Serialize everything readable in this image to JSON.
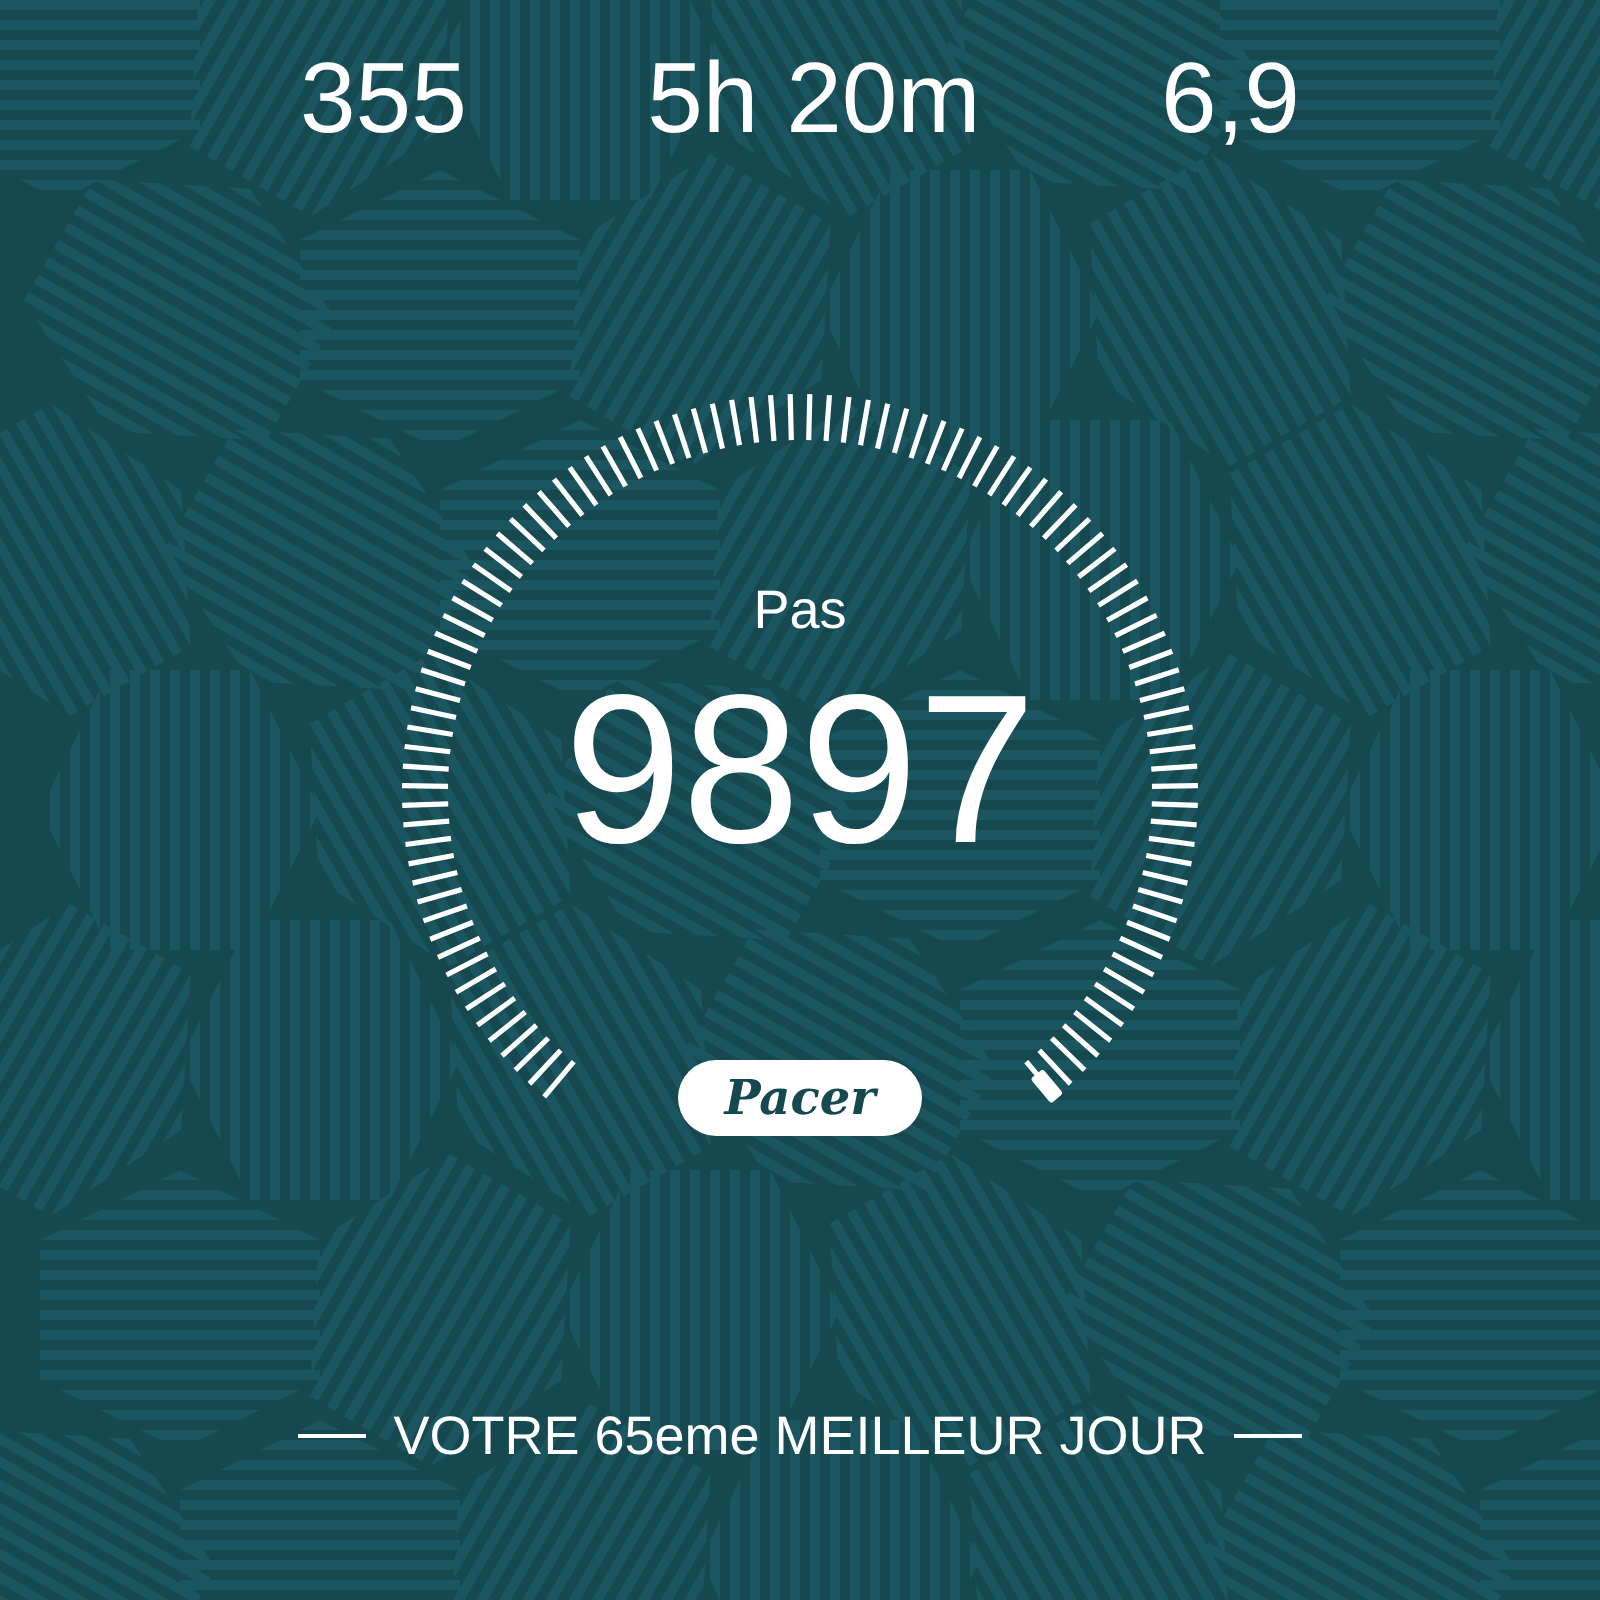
{
  "stats": [
    {
      "value": "355"
    },
    {
      "value": "5h 20m"
    },
    {
      "value": "6,9"
    }
  ],
  "gauge": {
    "label": "Pas",
    "value": "9897"
  },
  "logo": "Pacer",
  "banner": "VOTRE 65eme MEILLEUR JOUR"
}
